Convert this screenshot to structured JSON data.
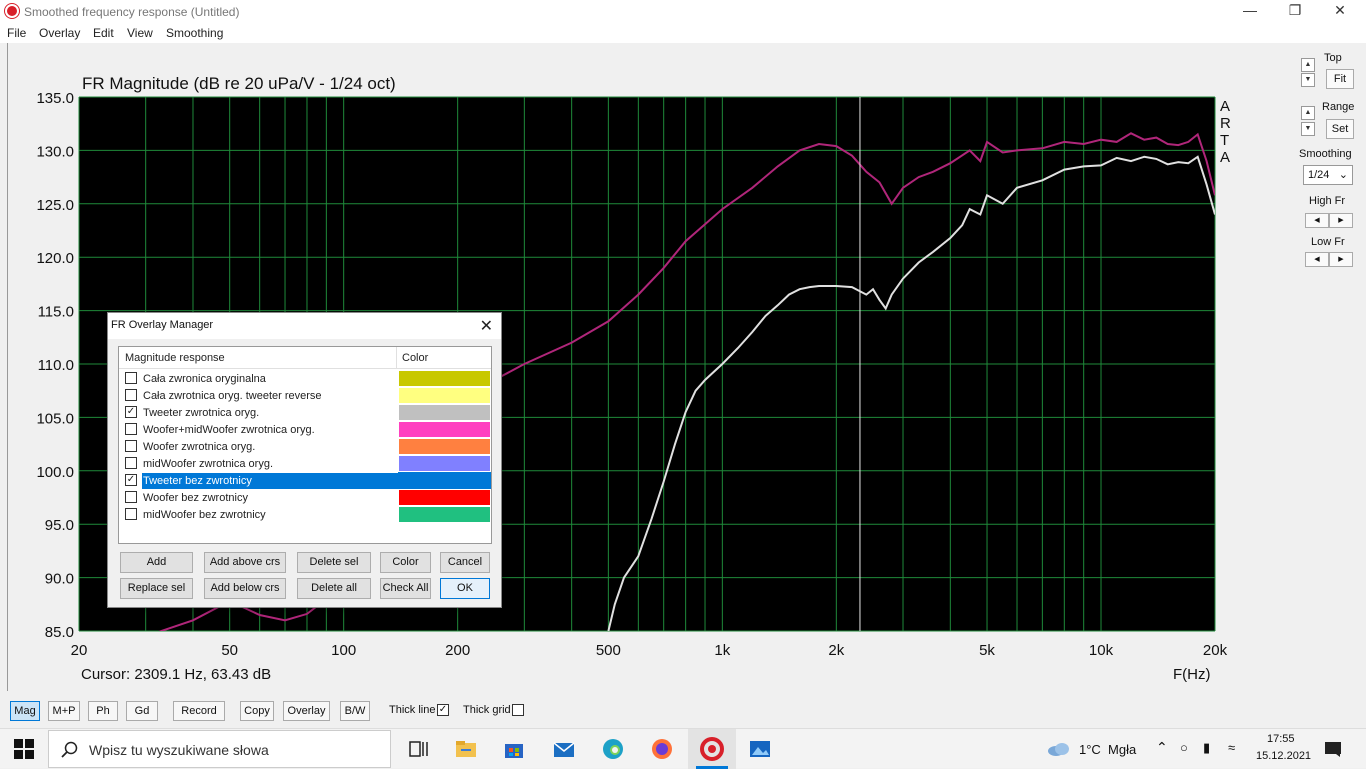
{
  "window": {
    "title": "Smoothed frequency response (Untitled)",
    "menu": [
      "File",
      "Overlay",
      "Edit",
      "View",
      "Smoothing"
    ]
  },
  "chart_data": {
    "type": "line",
    "title": "FR Magnitude (dB re 20 uPa/V - 1/24 oct)",
    "xlabel": "F(Hz)",
    "x_scale": "log",
    "xlim": [
      20,
      20000
    ],
    "ylim": [
      85,
      135
    ],
    "x_ticks": [
      {
        "v": 20,
        "label": "20"
      },
      {
        "v": 50,
        "label": "50"
      },
      {
        "v": 100,
        "label": "100"
      },
      {
        "v": 200,
        "label": "200"
      },
      {
        "v": 500,
        "label": "500"
      },
      {
        "v": 1000,
        "label": "1k"
      },
      {
        "v": 2000,
        "label": "2k"
      },
      {
        "v": 5000,
        "label": "5k"
      },
      {
        "v": 10000,
        "label": "10k"
      },
      {
        "v": 20000,
        "label": "20k"
      }
    ],
    "y_ticks": [
      "135.0",
      "130.0",
      "125.0",
      "120.0",
      "115.0",
      "110.0",
      "105.0",
      "100.0",
      "95.0",
      "90.0",
      "85.0"
    ],
    "cursor_hz": 2309.1,
    "cursor_text": "Cursor: 2309.1 Hz, 63.43 dB",
    "side_label": [
      "A",
      "R",
      "T",
      "A"
    ],
    "grid": true,
    "background": "#000000",
    "grid_color": "#1f8a3a",
    "series": [
      {
        "color": "#b0267a",
        "x": [
          20,
          30,
          40,
          50,
          60,
          70,
          80,
          90,
          100,
          120,
          150,
          200,
          250,
          300,
          400,
          500,
          600,
          700,
          800,
          1000,
          1200,
          1400,
          1600,
          1800,
          2000,
          2200,
          2400,
          2600,
          2800,
          3000,
          3300,
          3600,
          4000,
          4500,
          4800,
          5000,
          5500,
          6000,
          7000,
          8000,
          9000,
          10000,
          11000,
          12000,
          13000,
          14000,
          15000,
          16000,
          17000,
          18000,
          19000,
          20000
        ],
        "y": [
          83.5,
          84.5,
          86.0,
          87.8,
          86.5,
          86.0,
          86.6,
          88.0,
          89.5,
          95.0,
          102.0,
          106.5,
          108.5,
          110.0,
          112.0,
          114.0,
          116.5,
          119.0,
          121.5,
          124.5,
          126.5,
          128.5,
          130.0,
          130.6,
          130.4,
          129.5,
          128.0,
          127.0,
          125.0,
          126.5,
          127.5,
          128.0,
          128.8,
          130.0,
          129.0,
          130.8,
          129.8,
          130.0,
          130.2,
          130.8,
          130.6,
          131.0,
          130.8,
          131.6,
          131.0,
          131.2,
          130.6,
          130.5,
          130.8,
          131.5,
          129.0,
          125.8
        ]
      },
      {
        "color": "#e0e0e0",
        "x": [
          500,
          520,
          550,
          600,
          650,
          700,
          750,
          800,
          850,
          900,
          1000,
          1100,
          1200,
          1300,
          1400,
          1500,
          1600,
          1700,
          1800,
          2000,
          2200,
          2400,
          2500,
          2600,
          2700,
          2800,
          3000,
          3300,
          3600,
          4000,
          4300,
          4500,
          4800,
          5000,
          5500,
          6000,
          7000,
          8000,
          9000,
          10000,
          11000,
          12000,
          13000,
          14000,
          15000,
          16000,
          17000,
          18000,
          19000,
          20000
        ],
        "y": [
          85.0,
          87.5,
          90.0,
          92.0,
          95.5,
          99.0,
          102.5,
          105.5,
          107.5,
          108.5,
          110.0,
          111.5,
          113.0,
          114.5,
          115.5,
          116.5,
          117.0,
          117.2,
          117.3,
          117.3,
          117.2,
          116.5,
          117.0,
          116.0,
          115.2,
          116.5,
          118.0,
          119.5,
          120.5,
          121.8,
          123.0,
          124.5,
          124.0,
          125.8,
          125.0,
          126.5,
          127.2,
          128.2,
          128.5,
          128.6,
          129.3,
          129.0,
          129.4,
          129.2,
          128.7,
          128.9,
          128.8,
          129.4,
          126.8,
          124.0
        ]
      }
    ]
  },
  "right_panel": {
    "top_label": "Top",
    "fit_label": "Fit",
    "range_label": "Range",
    "set_label": "Set",
    "smoothing_label": "Smoothing",
    "smoothing_value": "1/24",
    "high_fr_label": "High Fr",
    "low_fr_label": "Low Fr"
  },
  "bottom_toolbar": {
    "buttons": [
      "Mag",
      "M+P",
      "Ph",
      "Gd",
      "Record",
      "Copy",
      "Overlay",
      "B/W"
    ],
    "thick_line_label": "Thick line",
    "thick_line_checked": true,
    "thick_grid_label": "Thick grid",
    "thick_grid_checked": false
  },
  "dialog": {
    "title": "FR Overlay Manager",
    "col_name": "Magnitude response",
    "col_color": "Color",
    "rows": [
      {
        "name": "Cała zwronica oryginalna",
        "checked": false,
        "color": "#c8c800",
        "selected": false
      },
      {
        "name": "Cała zwrotnica oryg. tweeter reverse",
        "checked": false,
        "color": "#ffff80",
        "selected": false
      },
      {
        "name": "Tweeter zwrotnica oryg.",
        "checked": true,
        "color": "#c0c0c0",
        "selected": false
      },
      {
        "name": "Woofer+midWoofer zwrotnica oryg.",
        "checked": false,
        "color": "#ff40c0",
        "selected": false
      },
      {
        "name": "Woofer zwrotnica oryg.",
        "checked": false,
        "color": "#ff8040",
        "selected": false
      },
      {
        "name": "midWoofer zwrotnica oryg.",
        "checked": false,
        "color": "#8080ff",
        "selected": false
      },
      {
        "name": "Tweeter bez zwrotnicy",
        "checked": true,
        "color": "#0078d7",
        "selected": true
      },
      {
        "name": "Woofer bez zwrotnicy",
        "checked": false,
        "color": "#ff0000",
        "selected": false
      },
      {
        "name": "midWoofer bez zwrotnicy",
        "checked": false,
        "color": "#20c080",
        "selected": false
      }
    ],
    "buttons_row1": [
      "Add",
      "Add above crs",
      "Delete sel",
      "Color",
      "Cancel"
    ],
    "buttons_row2": [
      "Replace sel",
      "Add below crs",
      "Delete all",
      "Check All",
      "OK"
    ]
  },
  "taskbar": {
    "search_placeholder": "Wpisz tu wyszukiwane słowa",
    "weather": "1°C  Mgła",
    "time": "17:55",
    "date": "15.12.2021"
  }
}
